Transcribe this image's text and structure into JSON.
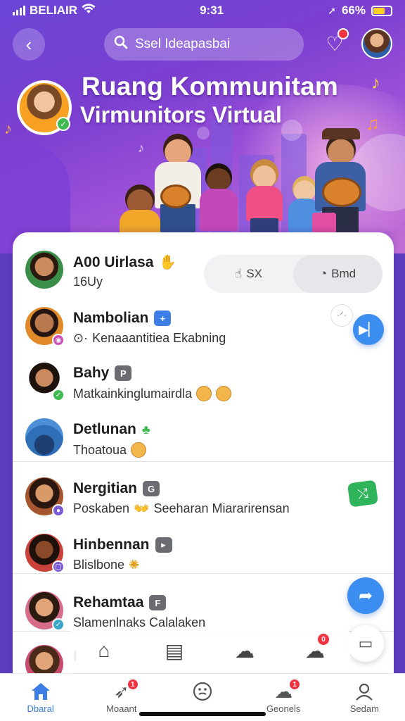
{
  "status_bar": {
    "carrier": "BELIAIR",
    "time": "9:31",
    "battery": "66%",
    "battery_level": 0.66
  },
  "header": {
    "search_placeholder": "Ssel Ideapasbai",
    "notification_count": "",
    "title_line1": "Ruang Kommunitam",
    "title_line2": "Virmunitors Virtual"
  },
  "segment": {
    "options": [
      {
        "label": "SX"
      },
      {
        "label": "Bmd"
      }
    ]
  },
  "chats": [
    {
      "name": "A00 Uirlasa",
      "sub": "16Uy",
      "badge": "",
      "color": "#3b8d4a"
    },
    {
      "name": "Nambolian",
      "sub": "Kenaaantitiea Ekabning",
      "badge": "+",
      "color": "#e08a2a"
    },
    {
      "name": "Bahy",
      "sub": "Matkainkinglumairdla",
      "badge": "P",
      "color": "#7a5236"
    },
    {
      "name": "Detlunan",
      "sub": "Thoatoua",
      "badge": "",
      "color": "#2f6fb8"
    },
    {
      "name": "Nergitian",
      "sub": "Poskaben",
      "sub2": "Seeharan Miararirensan",
      "badge": "G",
      "color": "#a5562e"
    },
    {
      "name": "Hinbennan",
      "sub": "Blislbone",
      "badge": "▸",
      "color": "#c9433a"
    },
    {
      "name": "Rehamtaa",
      "sub": "Slamenlnaks Calalaken",
      "badge": "F",
      "color": "#d66b8a"
    },
    {
      "name": "I",
      "sub": "",
      "badge": "",
      "color": "#c84a6e"
    }
  ],
  "floating_toolbar": {
    "items": [
      {
        "icon": "home-outline-icon"
      },
      {
        "icon": "list-icon"
      },
      {
        "icon": "chat-bubble-icon"
      },
      {
        "icon": "notification-icon",
        "badge": "0"
      }
    ]
  },
  "bottom_nav": {
    "items": [
      {
        "label": "Dbaral",
        "icon": "home-icon",
        "active": true
      },
      {
        "label": "Moaant",
        "icon": "rocket-icon",
        "badge": "1"
      },
      {
        "label": "",
        "icon": "dice-icon"
      },
      {
        "label": "Geonels",
        "icon": "groups-icon",
        "badge": "1"
      },
      {
        "label": "Sedam",
        "icon": "profile-icon"
      }
    ]
  },
  "colors": {
    "accent": "#3c8df0",
    "hero_start": "#6a45d6",
    "hero_end": "#c46fd6",
    "badge": "#ef3340"
  }
}
